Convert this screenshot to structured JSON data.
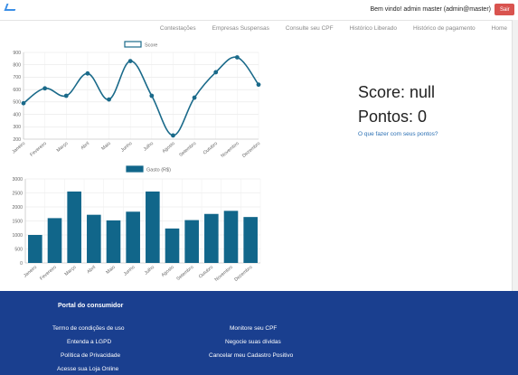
{
  "header": {
    "greeting": "Bem vindo! admin master (admin@master)",
    "exit_label": "Sair"
  },
  "nav": {
    "items": [
      "Contestações",
      "Empresas Suspensas",
      "Consulte seu CPF",
      "Histórico Liberado",
      "Histórico de pagamento",
      "Home"
    ]
  },
  "summary": {
    "score_text": "Score: null",
    "points_text": "Pontos: 0",
    "points_link": "O que fazer com seus pontos?"
  },
  "chart_data": [
    {
      "type": "line",
      "title": "",
      "legend": "Score",
      "categories": [
        "Janeiro",
        "Fevereiro",
        "Março",
        "Abril",
        "Maio",
        "Junho",
        "Julho",
        "Agosto",
        "Setembro",
        "Outubro",
        "Novembro",
        "Dezembro"
      ],
      "values": [
        490,
        610,
        550,
        730,
        520,
        830,
        550,
        230,
        535,
        740,
        860,
        640
      ],
      "ylim": [
        200,
        900
      ],
      "yticks": [
        200,
        300,
        400,
        500,
        600,
        700,
        800,
        900
      ],
      "color": "#1a6a8a",
      "grid": true,
      "legend_position": "top"
    },
    {
      "type": "bar",
      "title": "",
      "legend": "Gasto (R$)",
      "categories": [
        "Janeiro",
        "Fevereiro",
        "Março",
        "Abril",
        "Maio",
        "Junho",
        "Julho",
        "Agosto",
        "Setembro",
        "Outubro",
        "Novembro",
        "Dezembro"
      ],
      "values": [
        1000,
        1600,
        2550,
        1720,
        1520,
        1830,
        2550,
        1230,
        1530,
        1750,
        1860,
        1640
      ],
      "ylim": [
        0,
        3000
      ],
      "yticks": [
        0,
        500,
        1000,
        1500,
        2000,
        2500,
        3000
      ],
      "color": "#11668a",
      "grid": true,
      "legend_position": "top"
    }
  ],
  "footer": {
    "title": "Portal do consumidor",
    "col1": [
      "Termo de condições de uso",
      "Entenda a LGPD",
      "Política de Privacidade",
      "Acesse sua Loja Online"
    ],
    "col2": [
      "Monitore seu CPF",
      "Negocie suas dívidas",
      "Cancelar meu Cadastro Positivo"
    ]
  }
}
